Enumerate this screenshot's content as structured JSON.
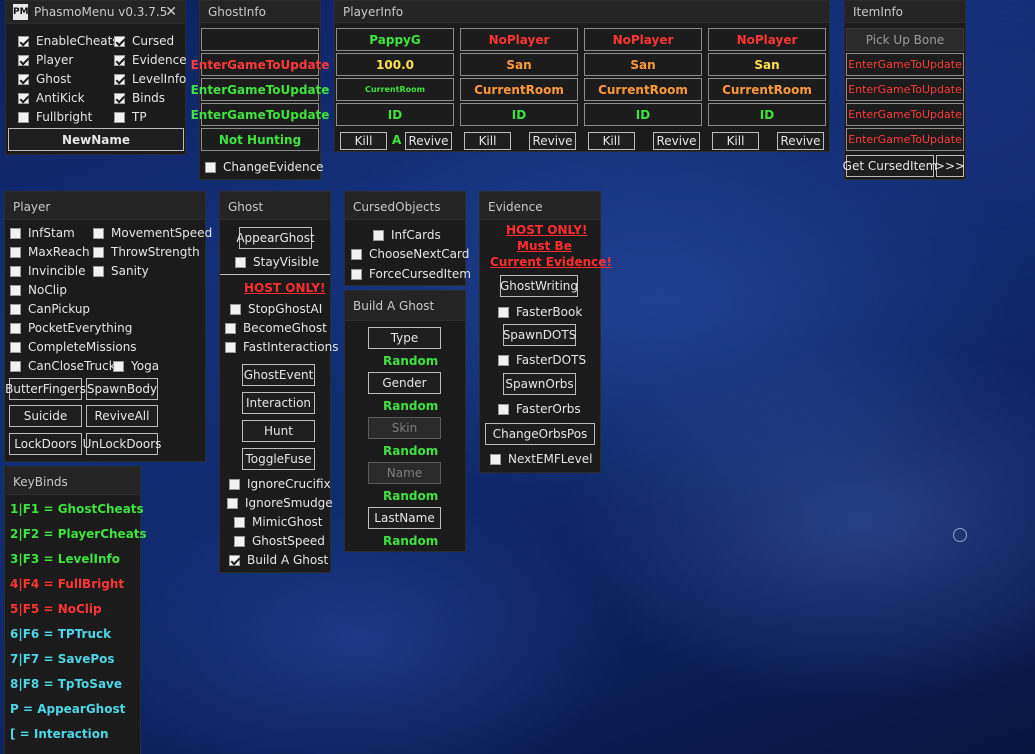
{
  "main": {
    "title": "PhasmoMenu v0.3.7.5",
    "logo": "PM",
    "close": "✕",
    "toggles": [
      {
        "label": "EnableCheats",
        "checked": true
      },
      {
        "label": "Cursed",
        "checked": true
      },
      {
        "label": "Player",
        "checked": true
      },
      {
        "label": "Evidence",
        "checked": true
      },
      {
        "label": "Ghost",
        "checked": true
      },
      {
        "label": "LevelInfo",
        "checked": true
      },
      {
        "label": "AntiKick",
        "checked": true
      },
      {
        "label": "Binds",
        "checked": true
      },
      {
        "label": "Fullbright",
        "checked": false
      },
      {
        "label": "TP",
        "checked": false
      }
    ],
    "name_button": "NewName"
  },
  "ghostinfo": {
    "title": "GhostInfo",
    "rows": [
      "",
      "EnterGameToUpdate",
      "EnterGameToUpdate",
      "EnterGameToUpdate",
      "Not Hunting"
    ],
    "change_evidence": "ChangeEvidence"
  },
  "playerinfo": {
    "title": "PlayerInfo",
    "players": [
      {
        "name": "PappyG",
        "stat": "100.0",
        "room": "CurrentRoom",
        "id": "ID",
        "kill": "Kill",
        "tag": "A",
        "revive": "Revive"
      },
      {
        "name": "NoPlayer",
        "stat": "San",
        "room": "CurrentRoom",
        "id": "ID",
        "kill": "Kill",
        "tag": "",
        "revive": "Revive"
      },
      {
        "name": "NoPlayer",
        "stat": "San",
        "room": "CurrentRoom",
        "id": "ID",
        "kill": "Kill",
        "tag": "",
        "revive": "Revive"
      },
      {
        "name": "NoPlayer",
        "stat": "San",
        "room": "CurrentRoom",
        "id": "ID",
        "kill": "Kill",
        "tag": "",
        "revive": "Revive"
      }
    ]
  },
  "iteminfo": {
    "title": "ItemInfo",
    "pickup": "Pick Up Bone",
    "rows": [
      "EnterGameToUpdate",
      "EnterGameToUpdate",
      "EnterGameToUpdate",
      "EnterGameToUpdate"
    ],
    "get_cursed": "Get CursedItem",
    "more": ">>>"
  },
  "player": {
    "title": "Player",
    "checks": [
      {
        "label": "InfStam",
        "checked": false
      },
      {
        "label": "MovementSpeed",
        "checked": false
      },
      {
        "label": "MaxReach",
        "checked": false
      },
      {
        "label": "ThrowStrength",
        "checked": false
      },
      {
        "label": "Invincible",
        "checked": false
      },
      {
        "label": "Sanity",
        "checked": false
      },
      {
        "label": "NoClip",
        "checked": false
      },
      {
        "label": "CanPickup",
        "checked": false
      },
      {
        "label": "PocketEverything",
        "checked": false
      },
      {
        "label": "CompleteMissions",
        "checked": false
      },
      {
        "label": "CanCloseTruck",
        "checked": false
      },
      {
        "label": "Yoga",
        "checked": false
      }
    ],
    "buttons": [
      "ButterFingers",
      "SpawnBody",
      "Suicide",
      "ReviveAll",
      "LockDoors",
      "UnLockDoors"
    ]
  },
  "ghost": {
    "title": "Ghost",
    "appear": "AppearGhost",
    "stay_visible": "StayVisible",
    "host_only": "HOST ONLY!",
    "host_checks": [
      "StopGhostAI",
      "BecomeGhost",
      "FastInteractions"
    ],
    "buttons": [
      "GhostEvent",
      "Interaction",
      "Hunt",
      "ToggleFuse"
    ],
    "bottom_checks": [
      {
        "label": "IgnoreCrucifix",
        "checked": false
      },
      {
        "label": "IgnoreSmudge",
        "checked": false
      },
      {
        "label": "MimicGhost",
        "checked": false
      },
      {
        "label": "GhostSpeed",
        "checked": false
      },
      {
        "label": "Build A Ghost",
        "checked": true
      }
    ]
  },
  "cursed": {
    "title": "CursedObjects",
    "checks": [
      "InfCards",
      "ChooseNextCard",
      "ForceCursedItem"
    ]
  },
  "build": {
    "title": "Build A Ghost",
    "fields": [
      {
        "label": "Type",
        "value": "Random",
        "dim": false
      },
      {
        "label": "Gender",
        "value": "Random",
        "dim": false
      },
      {
        "label": "Skin",
        "value": "Random",
        "dim": true
      },
      {
        "label": "Name",
        "value": "Random",
        "dim": true
      },
      {
        "label": "LastName",
        "value": "Random",
        "dim": false
      }
    ]
  },
  "evidence": {
    "title": "Evidence",
    "warn1": "HOST ONLY!",
    "warn2": "Must Be",
    "warn3": "Current Evidence!",
    "ghost_writing": "GhostWriting",
    "faster_book": "FasterBook",
    "spawn_dots": "SpawnDOTS",
    "faster_dots": "FasterDOTS",
    "spawn_orbs": "SpawnOrbs",
    "faster_orbs": "FasterOrbs",
    "change_orbs": "ChangeOrbsPos",
    "next_emf": "NextEMFLevel"
  },
  "keybinds": {
    "title": "KeyBinds",
    "items": [
      {
        "text": "1|F1 = GhostCheats",
        "color": "#3fe23f"
      },
      {
        "text": "2|F2 = PlayerCheats",
        "color": "#3fe23f"
      },
      {
        "text": "3|F3 = LevelInfo",
        "color": "#3fe23f"
      },
      {
        "text": "4|F4 = FullBright",
        "color": "#ff3535"
      },
      {
        "text": "5|F5 = NoClip",
        "color": "#ff3535"
      },
      {
        "text": "6|F6 = TPTruck",
        "color": "#4fd6e6"
      },
      {
        "text": "7|F7 = SavePos",
        "color": "#4fd6e6"
      },
      {
        "text": "8|F8 = TpToSave",
        "color": "#4fd6e6"
      },
      {
        "text": "P = AppearGhost",
        "color": "#4fd6e6"
      },
      {
        "text": "[ = Interaction",
        "color": "#4fd6e6"
      }
    ]
  }
}
